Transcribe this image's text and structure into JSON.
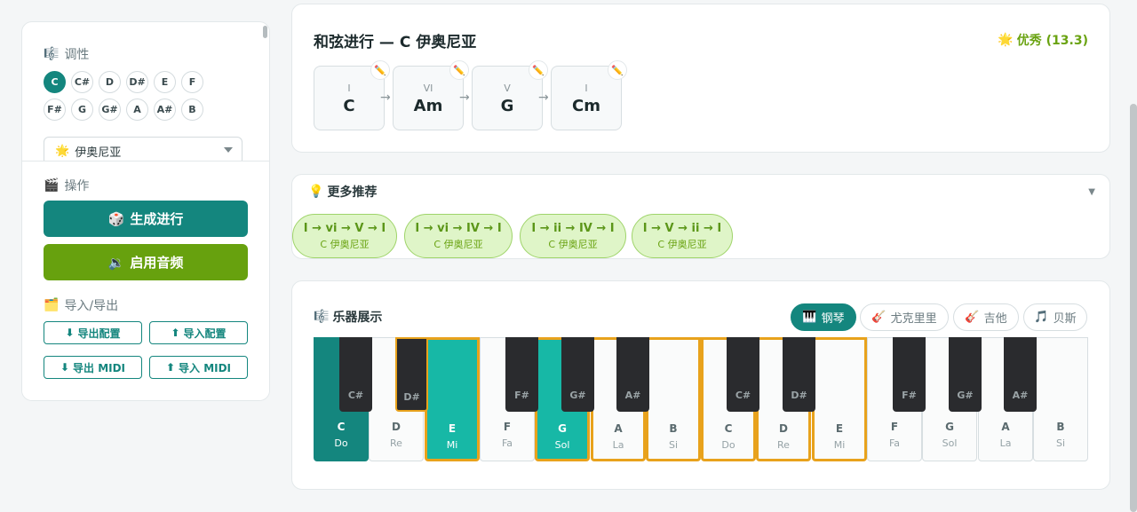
{
  "sidebar": {
    "key_title": "调性",
    "keys_row1": [
      "C",
      "C#",
      "D",
      "D#",
      "E",
      "F"
    ],
    "keys_row2": [
      "F#",
      "G",
      "G#",
      "A",
      "A#",
      "B"
    ],
    "active_key": "C",
    "mode_icon": "🌟",
    "mode_value": "伊奥尼亚",
    "ops_title": "操作",
    "generate_label": "生成进行",
    "audio_label": "启用音频",
    "io_title": "导入/导出",
    "export_config": "导出配置",
    "import_config": "导入配置",
    "export_midi": "导出 MIDI",
    "import_midi": "导入 MIDI"
  },
  "progression": {
    "title": "和弦进行 — C 伊奥尼亚",
    "rating_icon": "🌟",
    "rating": "优秀 (13.3)",
    "chords": [
      {
        "roman": "I",
        "name": "C"
      },
      {
        "roman": "VI",
        "name": "Am"
      },
      {
        "roman": "V",
        "name": "G"
      },
      {
        "roman": "I",
        "name": "Cm"
      }
    ]
  },
  "recommendations": {
    "title": "更多推荐",
    "items": [
      {
        "seq": "I → vi → V → I",
        "key": "C 伊奥尼亚"
      },
      {
        "seq": "I → vi → IV → I",
        "key": "C 伊奥尼亚"
      },
      {
        "seq": "I → ii → IV → I",
        "key": "C 伊奥尼亚"
      },
      {
        "seq": "I → V → ii → I",
        "key": "C 伊奥尼亚"
      }
    ]
  },
  "instrument": {
    "title": "乐器展示",
    "tabs": [
      {
        "icon": "🎹",
        "label": "钢琴",
        "active": true
      },
      {
        "icon": "🎸",
        "label": "尤克里里",
        "active": false
      },
      {
        "icon": "🎸",
        "label": "吉他",
        "active": false
      },
      {
        "icon": "🎵",
        "label": "贝斯",
        "active": false
      }
    ],
    "white_keys": [
      {
        "note": "C",
        "solf": "Do",
        "state": "teal"
      },
      {
        "note": "D",
        "solf": "Re",
        "state": ""
      },
      {
        "note": "E",
        "solf": "Mi",
        "state": "lteal"
      },
      {
        "note": "F",
        "solf": "Fa",
        "state": ""
      },
      {
        "note": "G",
        "solf": "Sol",
        "state": "lteal"
      },
      {
        "note": "A",
        "solf": "La",
        "state": "hl"
      },
      {
        "note": "B",
        "solf": "Si",
        "state": "hl"
      },
      {
        "note": "C",
        "solf": "Do",
        "state": "hl"
      },
      {
        "note": "D",
        "solf": "Re",
        "state": "hl"
      },
      {
        "note": "E",
        "solf": "Mi",
        "state": "hl"
      },
      {
        "note": "F",
        "solf": "Fa",
        "state": ""
      },
      {
        "note": "G",
        "solf": "Sol",
        "state": ""
      },
      {
        "note": "A",
        "solf": "La",
        "state": ""
      },
      {
        "note": "B",
        "solf": "Si",
        "state": ""
      }
    ],
    "black_keys": [
      {
        "note": "C#",
        "state": ""
      },
      {
        "note": "D#",
        "state": "hl"
      },
      {
        "note": "F#",
        "state": ""
      },
      {
        "note": "G#",
        "state": ""
      },
      {
        "note": "A#",
        "state": ""
      },
      {
        "note": "C#",
        "state": ""
      },
      {
        "note": "D#",
        "state": ""
      },
      {
        "note": "F#",
        "state": ""
      },
      {
        "note": "G#",
        "state": ""
      },
      {
        "note": "A#",
        "state": ""
      }
    ]
  },
  "colors": {
    "accent": "#14867e",
    "green": "#67a10e",
    "highlight": "#e8a21c"
  }
}
